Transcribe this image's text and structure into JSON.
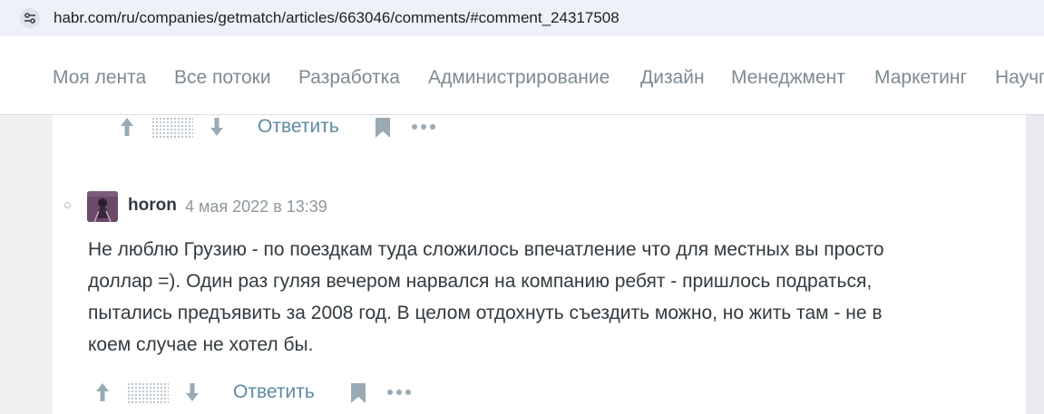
{
  "browser": {
    "url": "habr.com/ru/companies/getmatch/articles/663046/comments/#comment_24317508",
    "site_settings_icon": "tune-icon"
  },
  "nav": {
    "items": [
      {
        "label": "Моя лента"
      },
      {
        "label": "Все потоки"
      },
      {
        "label": "Разработка"
      },
      {
        "label": "Администрирование"
      },
      {
        "label": "Дизайн"
      },
      {
        "label": "Менеджмент"
      },
      {
        "label": "Маркетинг"
      },
      {
        "label": "Научпоп"
      }
    ]
  },
  "prev_comment": {
    "reply_label": "Ответить"
  },
  "comment": {
    "username": "horon",
    "timestamp": "4 мая 2022 в 13:39",
    "lines": [
      "Не люблю Грузию - по поездкам туда сложилось впечатление что для местных вы просто",
      "доллар =). Один раз гуляя вечером нарвался на компанию ребят - пришлось подраться,",
      "пытались предъявить за 2008 год. В целом отдохнуть съездить можно, но жить там - не в",
      "коем случае не хотел бы."
    ],
    "reply_label": "Ответить"
  },
  "colors": {
    "nav_text": "#7e8a92",
    "link": "#5e8aa3",
    "icon": "#9aaab4",
    "body_text": "#333a3f",
    "page_bg": "#f0f0f3"
  }
}
